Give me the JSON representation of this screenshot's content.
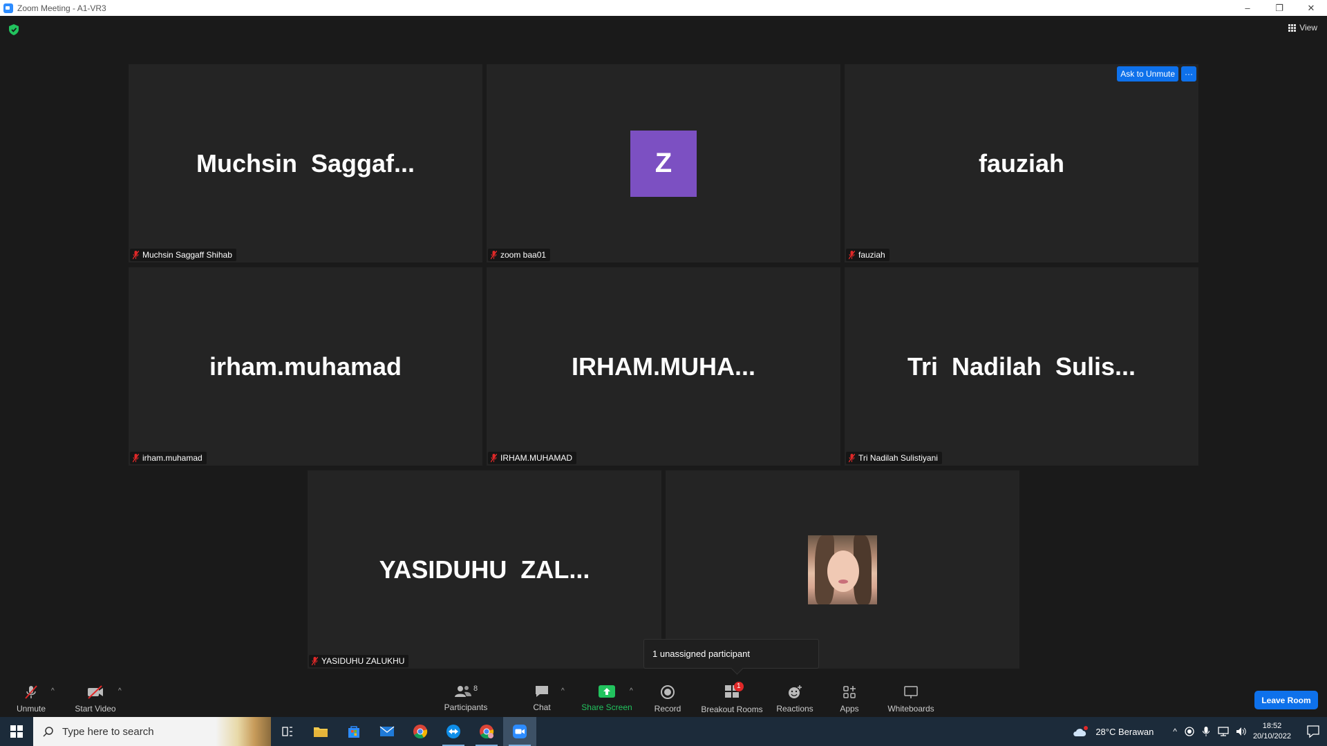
{
  "window": {
    "title": "Zoom Meeting - A1-VR3",
    "minimize": "–",
    "restore": "❐",
    "close": "✕"
  },
  "header": {
    "view_label": "View"
  },
  "tiles": [
    {
      "display": "Muchsin  Saggaf...",
      "name": "Muchsin Saggaff Shihab"
    },
    {
      "display": "Z",
      "name": "zoom baa01"
    },
    {
      "display": "fauziah",
      "name": "fauziah",
      "ask_label": "Ask to Unmute",
      "more_label": "···"
    },
    {
      "display": "irham.muhamad",
      "name": "irham.muhamad"
    },
    {
      "display": "IRHAM.MUHA...",
      "name": "IRHAM.MUHAMAD"
    },
    {
      "display": "Tri  Nadilah  Sulis...",
      "name": "Tri Nadilah Sulistiyani"
    },
    {
      "display": "YASIDUHU  ZAL...",
      "name": "YASIDUHU ZALUKHU"
    }
  ],
  "tooltip": {
    "text": "1 unassigned participant"
  },
  "toolbar": {
    "unmute": "Unmute",
    "start_video": "Start Video",
    "participants": "Participants",
    "participants_count": "8",
    "chat": "Chat",
    "share_screen": "Share Screen",
    "record": "Record",
    "breakout_rooms": "Breakout Rooms",
    "breakout_badge": "1",
    "reactions": "Reactions",
    "apps": "Apps",
    "whiteboards": "Whiteboards",
    "leave": "Leave Room"
  },
  "taskbar": {
    "search_placeholder": "Type here to search",
    "weather": "28°C  Berawan",
    "time": "18:52",
    "date": "20/10/2022"
  },
  "colors": {
    "accent": "#0e71eb",
    "share_green": "#22c35e",
    "avatar_purple": "#7c50c2",
    "muted_red": "#e02828"
  }
}
